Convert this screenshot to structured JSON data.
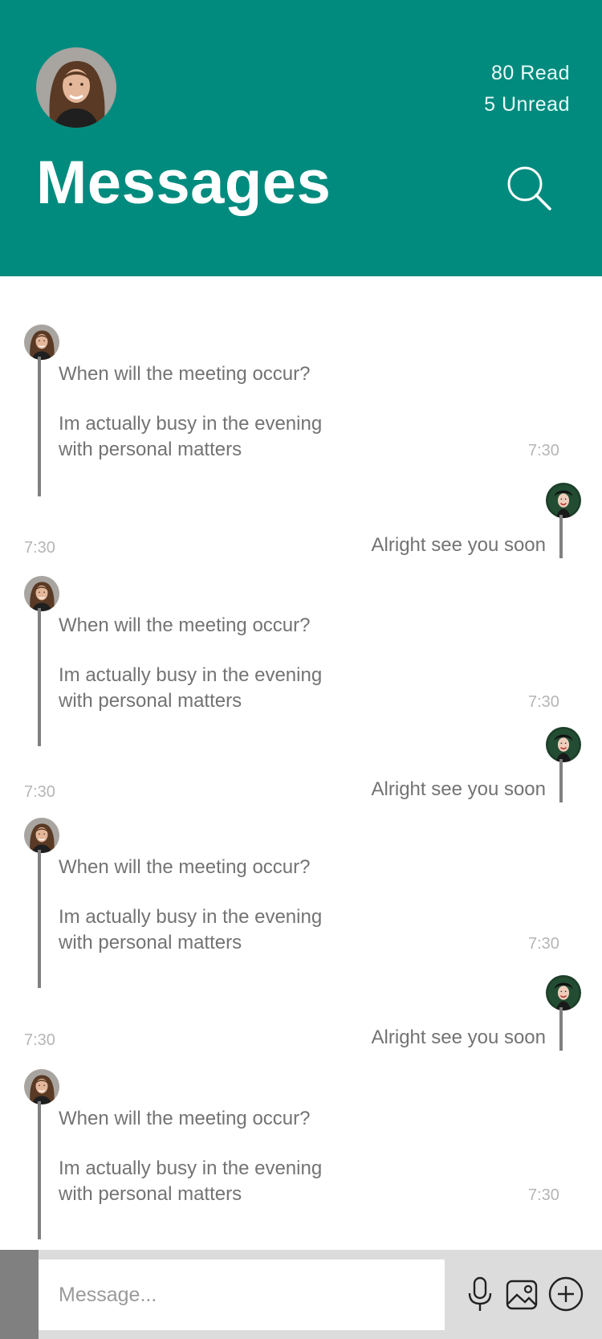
{
  "header": {
    "title": "Messages",
    "read_count": "80 Read",
    "unread_count": "5 Unread"
  },
  "messages": [
    {
      "side": "incoming",
      "lines": [
        "When will the meeting occur?",
        "Im actually busy in the evening",
        "with personal matters"
      ],
      "time": "7:30"
    },
    {
      "side": "outgoing",
      "text": "Alright see you soon",
      "time": "7:30"
    },
    {
      "side": "incoming",
      "lines": [
        "When will the meeting occur?",
        "Im actually busy in the evening",
        "with personal matters"
      ],
      "time": "7:30"
    },
    {
      "side": "outgoing",
      "text": "Alright see you soon",
      "time": "7:30"
    },
    {
      "side": "incoming",
      "lines": [
        "When will the meeting occur?",
        "Im actually busy in the evening",
        "with personal matters"
      ],
      "time": "7:30"
    },
    {
      "side": "outgoing",
      "text": "Alright see you soon",
      "time": "7:30"
    },
    {
      "side": "incoming",
      "lines": [
        "When will the meeting occur?",
        "Im actually busy in the evening",
        "with personal matters"
      ],
      "time": "7:30"
    }
  ],
  "composer": {
    "placeholder": "Message...",
    "icons": [
      "microphone-icon",
      "image-icon",
      "plus-circle-icon"
    ]
  },
  "colors": {
    "header_bg": "#008b7e",
    "bar": "#808080",
    "text": "#737373",
    "time": "#b5b5b5",
    "composer_bg": "#dcdcdc"
  }
}
